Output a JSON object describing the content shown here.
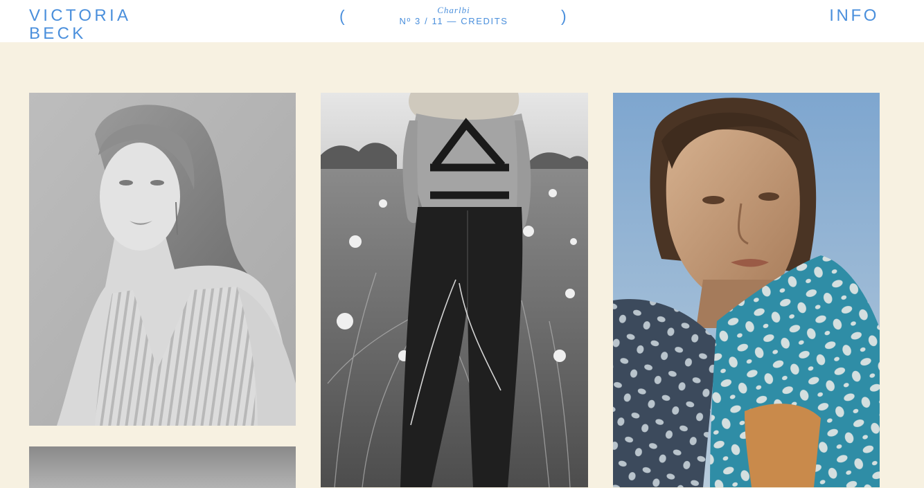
{
  "header": {
    "logo_line1": "VICTORIA",
    "logo_line2": "BECK",
    "prev_label": "(",
    "next_label": ")",
    "project_title": "Charlbi",
    "project_index": "Nº 3 / 11",
    "separator": "—",
    "credits_label": "CREDITS",
    "info_label": "INFO"
  },
  "colors": {
    "accent": "#4a8fdc",
    "page_background": "#f7f1e1",
    "header_background": "#ffffff"
  },
  "gallery": {
    "images": [
      {
        "name": "bw-portrait-woman-striped-top",
        "tone": "black-and-white"
      },
      {
        "name": "bw-woman-in-wildflower-field",
        "tone": "black-and-white"
      },
      {
        "name": "color-portrait-woman-blue-blanket",
        "tone": "color"
      },
      {
        "name": "bw-image-partial",
        "tone": "black-and-white"
      }
    ]
  }
}
